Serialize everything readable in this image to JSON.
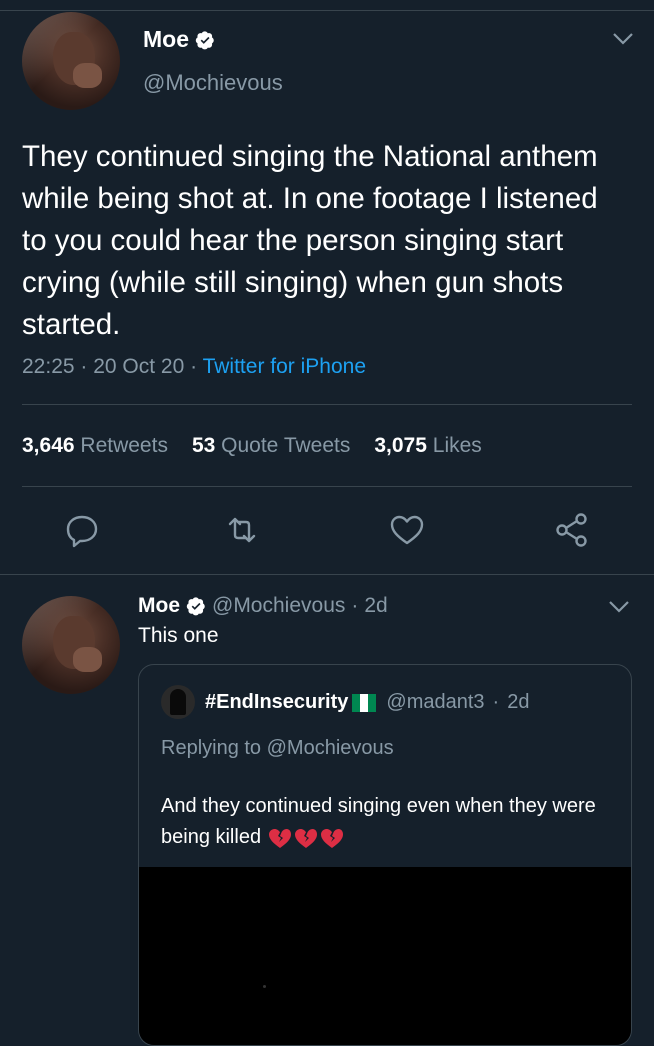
{
  "tweet": {
    "author_name": "Moe",
    "author_handle": "@Mochievous",
    "text": "They continued singing the National anthem while being shot at. In one footage I listened to you could hear the person singing start crying (while still singing) when gun shots started.",
    "time": "22:25",
    "date": "20 Oct 20",
    "source": "Twitter for iPhone",
    "stats": {
      "retweets_count": "3,646",
      "retweets_label": "Retweets",
      "quotes_count": "53",
      "quotes_label": "Quote Tweets",
      "likes_count": "3,075",
      "likes_label": "Likes"
    },
    "actions": [
      "reply-icon",
      "retweet-icon",
      "like-icon",
      "share-icon"
    ]
  },
  "reply": {
    "author_name": "Moe",
    "author_handle": "@Mochievous",
    "age": "2d",
    "text": "This one"
  },
  "quoted": {
    "author_name": "#EndInsecurity",
    "flag": "nigeria-flag",
    "author_handle": "@madant3",
    "age": "2d",
    "replying_to": "Replying to @Mochievous",
    "text": "And they continued singing even when they were being killed",
    "emoji": "broken-heart x3"
  },
  "colors": {
    "background": "#15202b",
    "secondary_text": "#8899a6",
    "link": "#1da1f2",
    "border": "#38444d",
    "flag_green": "#008751"
  }
}
